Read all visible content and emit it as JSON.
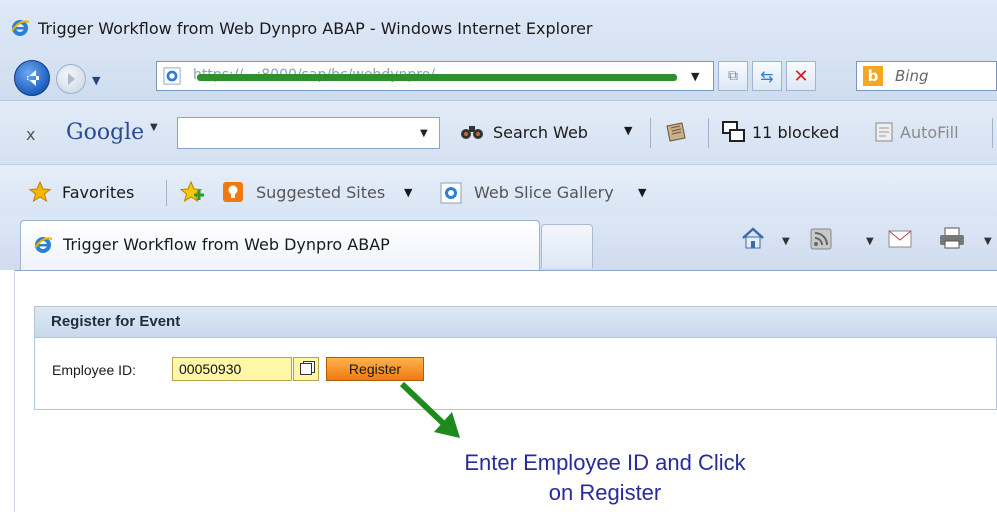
{
  "window": {
    "title": "Trigger Workflow from Web Dynpro ABAP - Windows Internet Explorer"
  },
  "address_bar": {
    "url": "https://...:8000/sap/bc/webdynpro/..."
  },
  "search_box": {
    "placeholder": "Bing"
  },
  "google_toolbar": {
    "close": "x",
    "logo": "Google",
    "search_web": "Search Web",
    "blocked": "11 blocked",
    "autofill": "AutoFill"
  },
  "favorites_bar": {
    "favorites": "Favorites",
    "suggested_sites": "Suggested Sites",
    "web_slice_gallery": "Web Slice Gallery"
  },
  "tabs": [
    {
      "label": "Trigger Workflow from Web Dynpro ABAP"
    }
  ],
  "page": {
    "panel_title": "Register for Event",
    "employee_label": "Employee ID:",
    "employee_value": "00050930",
    "register_button": "Register",
    "annotation_line1": "Enter Employee ID and Click",
    "annotation_line2": "on Register"
  },
  "colors": {
    "redaction": "#2f8f2f",
    "arrow": "#1e8a1e",
    "annotation_text": "#2a2a9c",
    "input_bg": "#fff7a8",
    "button": "#f07a10"
  },
  "icons": [
    "ie-icon",
    "back-icon",
    "forward-icon",
    "refresh-icon",
    "stop-icon",
    "bing-icon",
    "binoculars-icon",
    "news-icon",
    "popup-blocked-icon",
    "autofill-icon",
    "star-icon",
    "add-favorite-icon",
    "suggested-sites-icon",
    "home-icon",
    "rss-icon",
    "mail-icon",
    "print-icon",
    "value-help-icon"
  ]
}
